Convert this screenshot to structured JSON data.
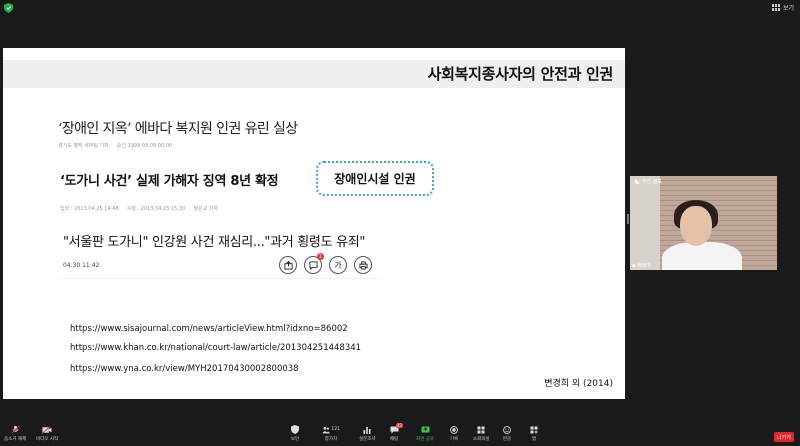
{
  "topbar": {
    "view_label": "보기"
  },
  "slide": {
    "title": "사회복지종사자의 안전과 인권",
    "headline1": "‘장애인 지옥’ 에바다 복지원 인권 유린 실상",
    "meta1": [
      "경기도 평택 세부팀 기자",
      "승인 1999.09.09 00:00"
    ],
    "headline2": "‘도가니 사건’ 실제 가해자 징역 8년 확정",
    "meta2": [
      "입력 : 2013.04.25 14:48",
      "수정 : 2013.04.25 15:30",
      "정은교 기자"
    ],
    "callout": "장애인시설 인권",
    "headline3": "\"서울판 도가니\" 인강원 사건 재심리...\"과거 횡령도 유죄\"",
    "meta3": "04.30 11:42",
    "tool_badge": "1",
    "tool_font": "가",
    "urls": [
      "https://www.sisajournal.com/news/articleView.html?idxno=86002",
      "https://www.khan.co.kr/national/court-law/article/201304251448341",
      "https://www.yna.co.kr/view/MYH20170430002800038"
    ],
    "credit": "변경희 외 (2014)"
  },
  "video": {
    "presenter_label": "주진 발표",
    "participant_name": "배정미"
  },
  "toolbar": {
    "items": [
      {
        "label": "음소거 해제"
      },
      {
        "label": "비디오 시작"
      },
      {
        "label": "보안"
      },
      {
        "label": "참가자",
        "count": "121"
      },
      {
        "label": "설문조사"
      },
      {
        "label": "채팅",
        "badge": "43"
      },
      {
        "label": "화면 공유"
      },
      {
        "label": "기록"
      },
      {
        "label": "소회의실"
      },
      {
        "label": "반응"
      },
      {
        "label": "앱"
      }
    ],
    "leave_label": "나가기"
  },
  "colors": {
    "accent_green": "#3ec34f",
    "callout_border": "#39a8c4",
    "leave_red": "#e02828"
  }
}
